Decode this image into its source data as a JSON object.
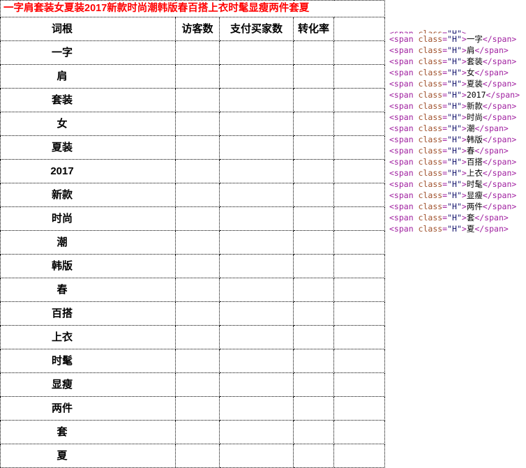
{
  "table": {
    "title": "一字肩套装女夏装2017新款时尚潮韩版春百搭上衣时髦显瘦两件套夏",
    "title_color": "#ff0000",
    "columns": [
      "词根",
      "访客数",
      "支付买家数",
      "转化率",
      ""
    ],
    "rows": [
      {
        "root": "一字",
        "uv": "",
        "buyers": "",
        "conv": "",
        "extra": ""
      },
      {
        "root": "肩",
        "uv": "",
        "buyers": "",
        "conv": "",
        "extra": ""
      },
      {
        "root": "套装",
        "uv": "",
        "buyers": "",
        "conv": "",
        "extra": ""
      },
      {
        "root": "女",
        "uv": "",
        "buyers": "",
        "conv": "",
        "extra": ""
      },
      {
        "root": "夏装",
        "uv": "",
        "buyers": "",
        "conv": "",
        "extra": ""
      },
      {
        "root": "2017",
        "uv": "",
        "buyers": "",
        "conv": "",
        "extra": ""
      },
      {
        "root": "新款",
        "uv": "",
        "buyers": "",
        "conv": "",
        "extra": ""
      },
      {
        "root": "时尚",
        "uv": "",
        "buyers": "",
        "conv": "",
        "extra": ""
      },
      {
        "root": "潮",
        "uv": "",
        "buyers": "",
        "conv": "",
        "extra": ""
      },
      {
        "root": "韩版",
        "uv": "",
        "buyers": "",
        "conv": "",
        "extra": ""
      },
      {
        "root": "春",
        "uv": "",
        "buyers": "",
        "conv": "",
        "extra": ""
      },
      {
        "root": "百搭",
        "uv": "",
        "buyers": "",
        "conv": "",
        "extra": ""
      },
      {
        "root": "上衣",
        "uv": "",
        "buyers": "",
        "conv": "",
        "extra": ""
      },
      {
        "root": "时髦",
        "uv": "",
        "buyers": "",
        "conv": "",
        "extra": ""
      },
      {
        "root": "显瘦",
        "uv": "",
        "buyers": "",
        "conv": "",
        "extra": ""
      },
      {
        "root": "两件",
        "uv": "",
        "buyers": "",
        "conv": "",
        "extra": ""
      },
      {
        "root": "套",
        "uv": "",
        "buyers": "",
        "conv": "",
        "extra": ""
      },
      {
        "root": "夏",
        "uv": "",
        "buyers": "",
        "conv": "",
        "extra": ""
      }
    ]
  },
  "code": {
    "syntax_colors": {
      "tag": "#a020a0",
      "attribute": "#a0522d",
      "value": "#191970",
      "text": "#000000"
    },
    "open_prefix": "<span ",
    "attr_name": "class",
    "equals": "=",
    "attr_value": "\"H\"",
    "open_suffix": ">",
    "close_tag": "</span>",
    "lines": [
      {
        "text": "一字"
      },
      {
        "text": "肩"
      },
      {
        "text": "套装"
      },
      {
        "text": "女"
      },
      {
        "text": "夏装"
      },
      {
        "text": "2017"
      },
      {
        "text": "新款"
      },
      {
        "text": "时尚"
      },
      {
        "text": "潮"
      },
      {
        "text": "韩版"
      },
      {
        "text": "春"
      },
      {
        "text": "百搭"
      },
      {
        "text": "上衣"
      },
      {
        "text": "时髦"
      },
      {
        "text": "显瘦"
      },
      {
        "text": "两件"
      },
      {
        "text": "套"
      },
      {
        "text": "夏"
      }
    ]
  }
}
